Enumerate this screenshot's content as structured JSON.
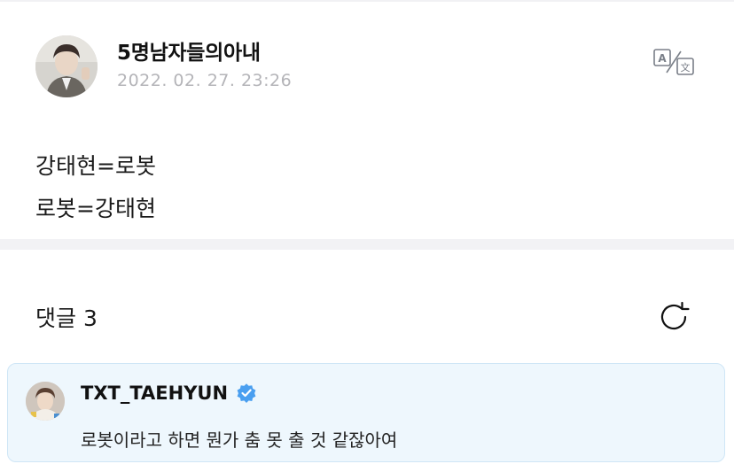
{
  "post": {
    "author": "5명남자들의아내",
    "timestamp": "2022. 02. 27. 23:26",
    "lines": [
      "강태현=로봇",
      "로봇=강태현"
    ]
  },
  "icons": {
    "translate": "translate-icon",
    "refresh": "refresh-icon",
    "verified": "verified-badge-icon"
  },
  "comments": {
    "header": "댓글 3",
    "items": [
      {
        "author": "TXT_TAEHYUN",
        "verified": true,
        "text": "로봇이라고 하면 뭔가 춤 못 출 것 같잖아여"
      }
    ]
  },
  "colors": {
    "comment_highlight_bg": "#eef7fd",
    "verified_blue": "#4a9ff0",
    "timestamp_gray": "#b4b4b8",
    "divider": "#f2f2f5"
  }
}
